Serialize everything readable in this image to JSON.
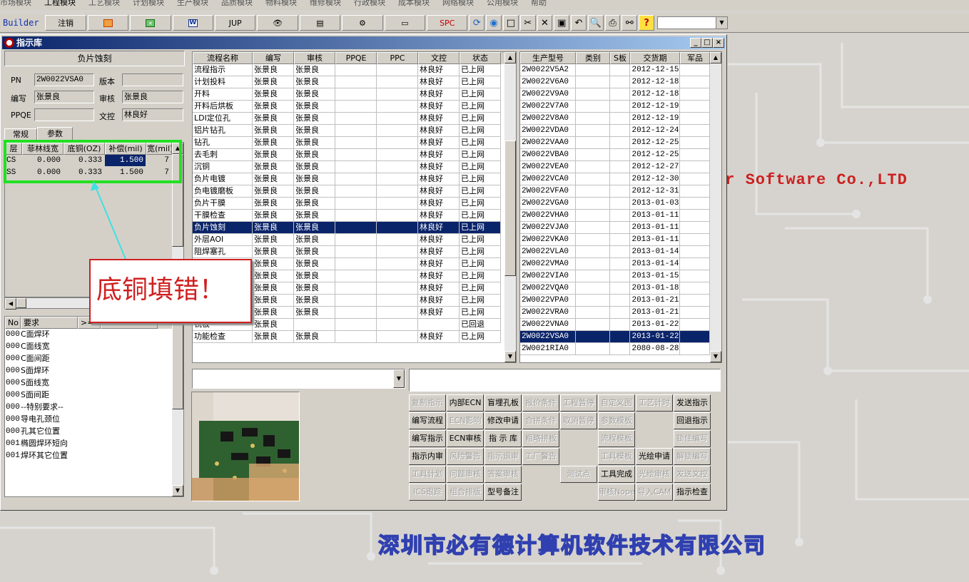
{
  "menu": [
    "市场模块",
    "工程模块",
    "工艺模块",
    "计划模块",
    "生产模块",
    "品质模块",
    "物料模块",
    "维修模块",
    "行政模块",
    "成本模块",
    "网络模块",
    "公用模块",
    "帮助"
  ],
  "toolbar": {
    "builder_label": "Builder",
    "logout_label": "注销",
    "jup_label": "JUP",
    "spc_label": "SPC"
  },
  "background": {
    "company_en": "er Software Co.,LTD",
    "company_cn": "深圳市必有德计算机软件技术有限公司"
  },
  "window": {
    "title": "指示库"
  },
  "left": {
    "product_name": "负片蚀刻",
    "pn_label": "PN",
    "pn_value": "2W0022VSA0",
    "version_label": "版本",
    "version_value": "",
    "editor_label": "编写",
    "editor_value": "张景良",
    "reviewer_label": "审核",
    "reviewer_value": "张景良",
    "ppqe_label": "PPQE",
    "ppqe_value": "",
    "doc_label": "文控",
    "doc_value": "林良好",
    "tabs": [
      "常规",
      "参数"
    ],
    "param_headers": [
      "层",
      "菲林线宽",
      "底铜(OZ)",
      "补偿(mil)",
      "宽(mil)"
    ],
    "param_rows": [
      [
        "CS",
        "0.000",
        "0.333",
        "1.500",
        "7"
      ],
      [
        "SS",
        "0.000",
        "0.333",
        "1.500",
        "7"
      ]
    ],
    "req_headers": [
      "No",
      "要求",
      ">="
    ],
    "req_rows": [
      [
        "000",
        "C面焊环"
      ],
      [
        "000",
        "C面线宽"
      ],
      [
        "000",
        "C面间距"
      ],
      [
        "000",
        "S面焊环"
      ],
      [
        "000",
        "S面线宽"
      ],
      [
        "000",
        "S面间距"
      ],
      [
        "000",
        "--特别要求--"
      ],
      [
        "000",
        "导电孔颈位"
      ],
      [
        "000",
        "孔其它位置"
      ],
      [
        "001",
        "椭圆焊环短向"
      ],
      [
        "001",
        "焊环其它位置"
      ]
    ]
  },
  "process": {
    "headers": [
      "流程名称",
      "编写",
      "审核",
      "PPQE",
      "PPC",
      "文控",
      "状态"
    ],
    "rows": [
      [
        "流程指示",
        "张景良",
        "张景良",
        "",
        "",
        "林良好",
        "已上网"
      ],
      [
        "计划投料",
        "张景良",
        "张景良",
        "",
        "",
        "林良好",
        "已上网"
      ],
      [
        "开料",
        "张景良",
        "张景良",
        "",
        "",
        "林良好",
        "已上网"
      ],
      [
        "开料后烘板",
        "张景良",
        "张景良",
        "",
        "",
        "林良好",
        "已上网"
      ],
      [
        "LDI定位孔",
        "张景良",
        "张景良",
        "",
        "",
        "林良好",
        "已上网"
      ],
      [
        "铝片钻孔",
        "张景良",
        "张景良",
        "",
        "",
        "林良好",
        "已上网"
      ],
      [
        "钻孔",
        "张景良",
        "张景良",
        "",
        "",
        "林良好",
        "已上网"
      ],
      [
        "去毛刺",
        "张景良",
        "张景良",
        "",
        "",
        "林良好",
        "已上网"
      ],
      [
        "沉铜",
        "张景良",
        "张景良",
        "",
        "",
        "林良好",
        "已上网"
      ],
      [
        "负片电镀",
        "张景良",
        "张景良",
        "",
        "",
        "林良好",
        "已上网"
      ],
      [
        "负电镀磨板",
        "张景良",
        "张景良",
        "",
        "",
        "林良好",
        "已上网"
      ],
      [
        "负片干膜",
        "张景良",
        "张景良",
        "",
        "",
        "林良好",
        "已上网"
      ],
      [
        "干膜检查",
        "张景良",
        "张景良",
        "",
        "",
        "林良好",
        "已上网"
      ],
      [
        "负片蚀刻",
        "张景良",
        "张景良",
        "",
        "",
        "林良好",
        "已上网"
      ],
      [
        "外层AOI",
        "张景良",
        "张景良",
        "",
        "",
        "林良好",
        "已上网"
      ],
      [
        "阻焊塞孔",
        "张景良",
        "张景良",
        "",
        "",
        "林良好",
        "已上网"
      ],
      [
        "",
        "张景良",
        "张景良",
        "",
        "",
        "林良好",
        "已上网"
      ],
      [
        "",
        "张景良",
        "张景良",
        "",
        "",
        "林良好",
        "已上网"
      ],
      [
        "",
        "张景良",
        "张景良",
        "",
        "",
        "林良好",
        "已上网"
      ],
      [
        "",
        "张景良",
        "张景良",
        "",
        "",
        "林良好",
        "已上网"
      ],
      [
        "",
        "张景良",
        "张景良",
        "",
        "",
        "林良好",
        "已上网"
      ],
      [
        "铣板",
        "张景良",
        "",
        "",
        "",
        "",
        "已回退"
      ],
      [
        "功能检查",
        "张景良",
        "张景良",
        "",
        "",
        "林良好",
        "已上网"
      ]
    ],
    "selected_index": 13
  },
  "models": {
    "headers": [
      "生产型号",
      "类别",
      "S板",
      "交货期",
      "军品"
    ],
    "rows": [
      [
        "2W0022V5A2",
        "",
        "",
        "2012-12-15",
        ""
      ],
      [
        "2W0022V6A0",
        "",
        "",
        "2012-12-18",
        ""
      ],
      [
        "2W0022V9A0",
        "",
        "",
        "2012-12-18",
        ""
      ],
      [
        "2W0022V7A0",
        "",
        "",
        "2012-12-19",
        ""
      ],
      [
        "2W0022V8A0",
        "",
        "",
        "2012-12-19",
        ""
      ],
      [
        "2W0022VDA0",
        "",
        "",
        "2012-12-24",
        ""
      ],
      [
        "2W0022VAA0",
        "",
        "",
        "2012-12-25",
        ""
      ],
      [
        "2W0022VBA0",
        "",
        "",
        "2012-12-25",
        ""
      ],
      [
        "2W0022VEA0",
        "",
        "",
        "2012-12-27",
        ""
      ],
      [
        "2W0022VCA0",
        "",
        "",
        "2012-12-30",
        ""
      ],
      [
        "2W0022VFA0",
        "",
        "",
        "2012-12-31",
        ""
      ],
      [
        "2W0022VGA0",
        "",
        "",
        "2013-01-03",
        ""
      ],
      [
        "2W0022VHA0",
        "",
        "",
        "2013-01-11",
        ""
      ],
      [
        "2W0022VJA0",
        "",
        "",
        "2013-01-11",
        ""
      ],
      [
        "2W0022VKA0",
        "",
        "",
        "2013-01-11",
        ""
      ],
      [
        "2W0022VLA0",
        "",
        "",
        "2013-01-14",
        ""
      ],
      [
        "2W0022VMA0",
        "",
        "",
        "2013-01-14",
        ""
      ],
      [
        "2W0022VIA0",
        "",
        "",
        "2013-01-15",
        ""
      ],
      [
        "2W0022VQA0",
        "",
        "",
        "2013-01-18",
        ""
      ],
      [
        "2W0022VPA0",
        "",
        "",
        "2013-01-21",
        ""
      ],
      [
        "2W0022VRA0",
        "",
        "",
        "2013-01-21",
        ""
      ],
      [
        "2W0022VNA0",
        "",
        "",
        "2013-01-22",
        ""
      ],
      [
        "2W0022VSA0",
        "",
        "",
        "2013-01-22",
        ""
      ],
      [
        "2W0021RIA0",
        "",
        "",
        "2080-08-28",
        ""
      ]
    ],
    "selected_index": 22
  },
  "actions": [
    [
      {
        "t": "复制指示",
        "d": true
      },
      {
        "t": "内部ECN",
        "d": false
      },
      {
        "t": "盲埋孔板",
        "d": false
      },
      {
        "t": "报价条件",
        "d": true
      },
      {
        "t": "工程暂停",
        "d": true
      },
      {
        "t": "自定义图",
        "d": true
      },
      {
        "t": "工艺计时",
        "d": true
      },
      {
        "t": "发送指示",
        "d": false
      }
    ],
    [
      {
        "t": "编写流程",
        "d": false
      },
      {
        "t": "ECN影响",
        "d": true
      },
      {
        "t": "修改申请",
        "d": false
      },
      {
        "t": "合拼条件",
        "d": true
      },
      {
        "t": "取消暂停",
        "d": true
      },
      {
        "t": "参数模板",
        "d": true
      },
      {
        "t": "",
        "d": true
      },
      {
        "t": "回退指示",
        "d": false
      }
    ],
    [
      {
        "t": "编写指示",
        "d": false
      },
      {
        "t": "ECN审核",
        "d": false
      },
      {
        "t": "指 示 库",
        "d": false
      },
      {
        "t": "粗略拼板",
        "d": true
      },
      {
        "t": "",
        "d": true
      },
      {
        "t": "流程模板",
        "d": true
      },
      {
        "t": "",
        "d": true
      },
      {
        "t": "锁住编写",
        "d": true
      }
    ],
    [
      {
        "t": "指示内审",
        "d": false
      },
      {
        "t": "风险警告",
        "d": true
      },
      {
        "t": "指示退审",
        "d": true
      },
      {
        "t": "工厂警告",
        "d": true
      },
      {
        "t": "",
        "d": true
      },
      {
        "t": "工具模板",
        "d": true
      },
      {
        "t": "光绘申请",
        "d": false
      },
      {
        "t": "解锁编写",
        "d": true
      }
    ],
    [
      {
        "t": "工具计划",
        "d": true
      },
      {
        "t": "问题审核",
        "d": true
      },
      {
        "t": "答案审核",
        "d": true
      },
      {
        "t": "",
        "d": true
      },
      {
        "t": "测试点",
        "d": true
      },
      {
        "t": "工具完成",
        "d": false
      },
      {
        "t": "光绘审核",
        "d": true
      },
      {
        "t": "发送文控",
        "d": true
      }
    ],
    [
      {
        "t": "ICS跟踪",
        "d": true
      },
      {
        "t": "组合排版",
        "d": true
      },
      {
        "t": "型号备注",
        "d": false
      },
      {
        "t": "",
        "d": true
      },
      {
        "t": "",
        "d": true
      },
      {
        "t": "审核Nope",
        "d": true
      },
      {
        "t": "导入CAM",
        "d": true
      },
      {
        "t": "指示检查",
        "d": false
      }
    ]
  ],
  "annotation": {
    "text": "底铜填错！",
    "color": "#d02020",
    "highlight_color": "#22e022",
    "arrow_color": "#40e0e0"
  }
}
